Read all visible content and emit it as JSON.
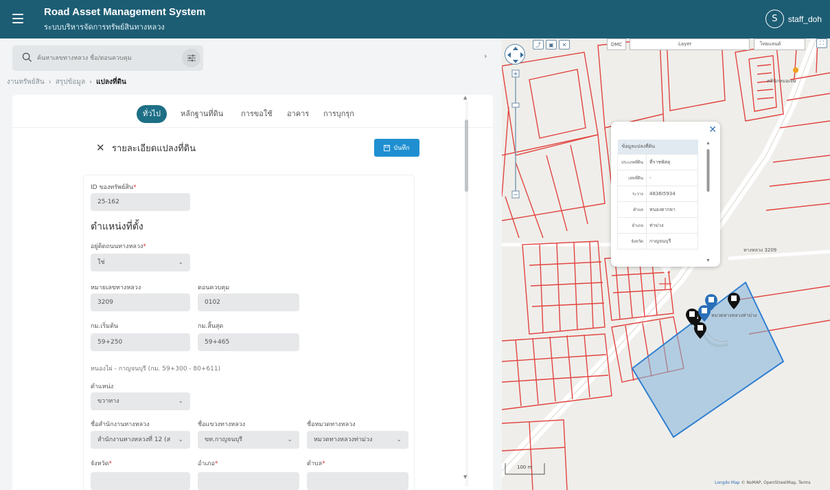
{
  "header": {
    "title": "Road Asset Management System",
    "subtitle": "ระบบบริหารจัดการทรัพย์สินทางหลวง",
    "user_initial": "S",
    "username": "staff_doh"
  },
  "search": {
    "placeholder": "ค้นหาเลขทางหลวง ชื่อ/ตอนควบคุม"
  },
  "breadcrumb": [
    "งานทรัพย์สิน",
    "สรุปข้อมูล",
    "แปลงที่ดิน"
  ],
  "tabs": [
    "ทั่วไป",
    "หลักฐานที่ดิน",
    "การขอใช้",
    "อาคาร",
    "การบุกรุก"
  ],
  "detail": {
    "title": "รายละเอียดแปลงที่ดิน",
    "save_label": "บันทึก"
  },
  "form": {
    "asset_id_label": "ID ของทรัพย์สิน",
    "asset_id_value": "25-162",
    "location_heading": "ตำแหน่งที่ตั้ง",
    "on_highway_label": "อยู่ติดถนนทางหลวง",
    "on_highway_value": "ใช่",
    "highway_no_label": "หมายเลขทางหลวง",
    "highway_no_value": "3209",
    "control_section_label": "ตอนควบคุม",
    "control_section_value": "0102",
    "km_start_label": "กม.เริ่มต้น",
    "km_start_value": "59+250",
    "km_end_label": "กม.สิ้นสุด",
    "km_end_value": "59+465",
    "route_note": "หนองไผ่ - กาญจนบุรี (กม. 59+300 - 80+611)",
    "side_label": "ตำแหน่ง",
    "side_value": "ขวาทาง",
    "office_label": "ชื่อสำนักงานทางหลวง",
    "office_value": "สำนักงานทางหลวงที่ 12 (ส",
    "district_office_label": "ชื่อแขวงทางหลวง",
    "district_office_value": "ขท.กาญจนบุรี",
    "unit_label": "ชื่อหมวดทางหลวง",
    "unit_value": "หมวดทางหลวงท่าม่วง",
    "province_label": "จังหวัด",
    "amphoe_label": "อำเภอ",
    "tambon_label": "ตำบล"
  },
  "map": {
    "dmc_label": "DMC",
    "layer_label": "Layer",
    "basemap_label": "ไทยแลนด์",
    "place_label_1": "คลินิกหมอเจษ",
    "place_label_2": "หมวดทางหลวงท่าม่วง",
    "road_label": "ทางหลวง 3209",
    "scale_label": "100 m",
    "attribution_brand": "Longdo Map",
    "attribution_rest": " © NoMAP, OpenStreetMap, Terms",
    "popup": {
      "header": "ข้อมูลแปลงที่ดิน",
      "rows": [
        {
          "k": "ประเภทที่ดิน",
          "v": "ที่ราชพัสดุ"
        },
        {
          "k": "เลขที่ดิน",
          "v": "-"
        },
        {
          "k": "ระวาง",
          "v": "4836I5934"
        },
        {
          "k": "ตำบล",
          "v": "หนองตากยา"
        },
        {
          "k": "อำเภอ",
          "v": "ท่าม่วง"
        },
        {
          "k": "จังหวัด",
          "v": "กาญจนบุรี"
        }
      ]
    }
  },
  "colors": {
    "header_bg": "#1d5d74",
    "tab_active": "#1d6f86",
    "save_button": "#1f8fd1",
    "parcel_lines": "#e2433f",
    "selected_parcel": "#2f7fd1"
  }
}
